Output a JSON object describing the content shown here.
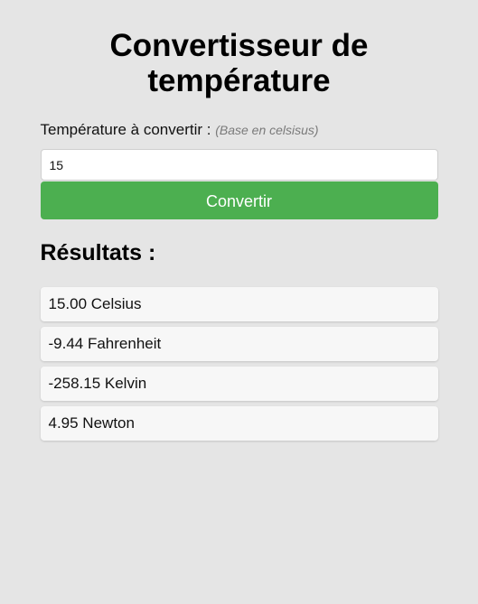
{
  "page": {
    "title": "Convertisseur de température"
  },
  "form": {
    "label": "Température à convertir :",
    "hint": "(Base en celsisus)",
    "input_value": "15",
    "button_label": "Convertir"
  },
  "results": {
    "title": "Résultats :",
    "items": [
      {
        "text": "15.00 Celsius"
      },
      {
        "text": "-9.44 Fahrenheit"
      },
      {
        "text": "-258.15 Kelvin"
      },
      {
        "text": "4.95 Newton"
      }
    ]
  },
  "colors": {
    "background": "#e5e5e5",
    "button": "#4caf50",
    "result_card": "#f7f7f7"
  }
}
